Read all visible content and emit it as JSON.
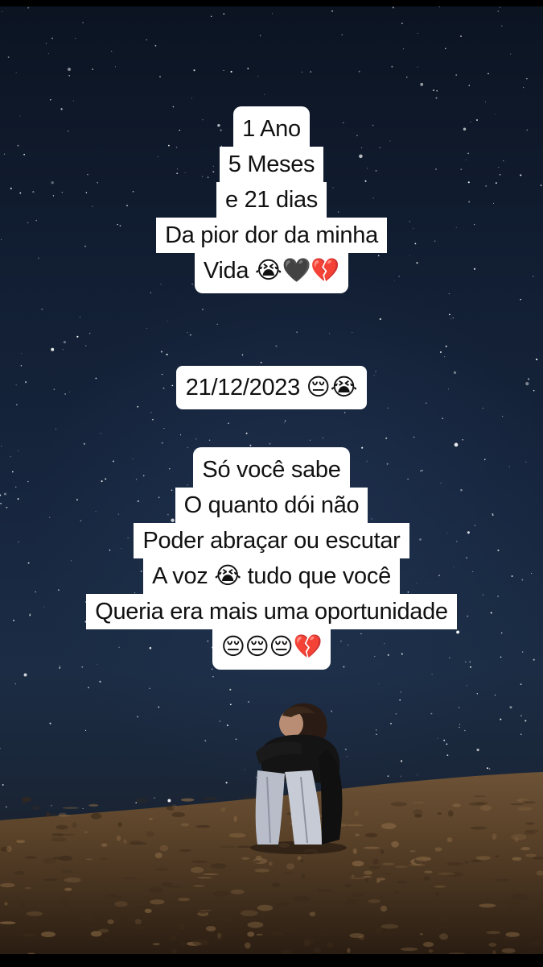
{
  "story": {
    "block1": {
      "lines": [
        "1 Ano",
        "5 Meses",
        "e 21 dias",
        "Da pior dor da minha",
        "Vida 😭🖤💔"
      ]
    },
    "block2": {
      "lines": [
        "21/12/2023 😔😭"
      ]
    },
    "block3": {
      "lines": [
        "Só você sabe",
        "O quanto dói não",
        "Poder abraçar ou escutar",
        "A voz 😭 tudo que você",
        "Queria era mais uma oportunidade",
        "😔😔😔💔"
      ]
    }
  },
  "colors": {
    "text_background": "#ffffff",
    "text_color": "#111111",
    "sky_top": "#0c1422",
    "sky_mid": "#1b2c44",
    "sand": "#7a5a38"
  }
}
